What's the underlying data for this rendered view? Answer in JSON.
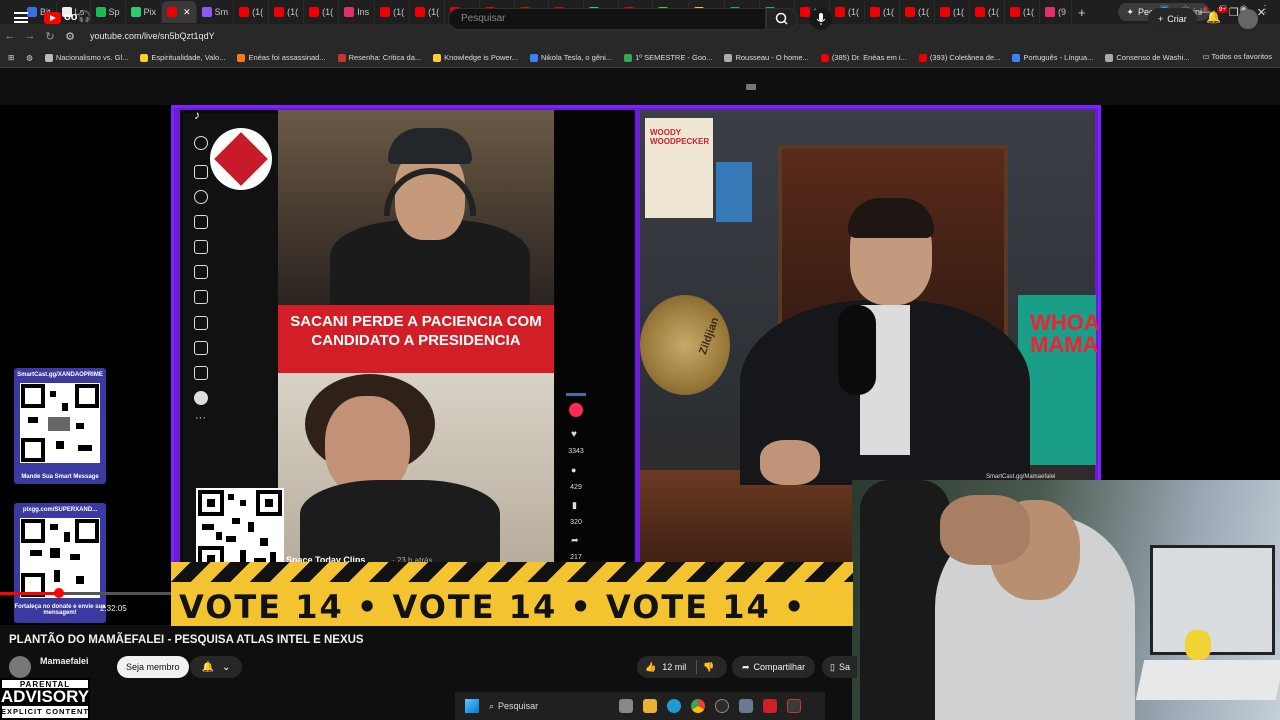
{
  "browser": {
    "tabs": [
      "Bit",
      "Lo",
      "Sp",
      "Pix",
      "",
      "Sm",
      "(1(",
      "(1(",
      "(1(",
      "Ins",
      "(1(",
      "(1(",
      "(1(",
      "(1(",
      "Yo",
      "(1(",
      "(1)",
      "Tri",
      "Str",
      "Cir",
      "Sh",
      "Str",
      "(1(",
      "(1(",
      "(1(",
      "(1(",
      "(1(",
      "(1(",
      "(1(",
      "(9"
    ],
    "new_tab": "+",
    "gemini_label": "Peça ao Gemini",
    "url": "youtube.com/live/sn5bQzt1qdY",
    "bookmarks": [
      "Nacionalismo vs. Gl...",
      "Espiritualidade, Valo...",
      "Enéas foi assassinad...",
      "Resenha: Crítica da...",
      "Knowledge is Power...",
      "Nikola Tesla, o gêni...",
      "1º SEMESTRE - Goo...",
      "Rousseau - O home...",
      "(385) Dr. Enéas em i...",
      "(393) Coletânea de...",
      "Português - Língua...",
      "Consenso de Washi..."
    ],
    "all_favorites": "Todos os favoritos"
  },
  "youtube": {
    "search_placeholder": "Pesquisar",
    "create_label": "Criar",
    "notif_badge": "9+"
  },
  "stream": {
    "banner_line1": "SACANI PERDE A PACIENCIA COM",
    "banner_line2": "CANDIDATO A PRESIDENCIA",
    "tiktok_counts": [
      "3343",
      "429",
      "320",
      "217"
    ],
    "tiktok_channel": "Space Today Clips",
    "tiktok_time": "· 23 h atrás",
    "poster_text": "WHOA MAMA",
    "woody_text": "WOODY WOODPECKER",
    "cymbal_text": "Zildjian",
    "smartcast_tag": "SmartCast.gg/Mamaefalei",
    "ticker_text": "VOTE 14  •  VOTE 14  •  VOTE 14  •",
    "qr1_top": "SmartCast.gg/XANDAOPRIME",
    "qr1_bottom": "Mande Sua Smart Message",
    "qr2_top": "pixgg.com/SUPERXAND...",
    "qr2_bottom": "Fortaleça no donate e envie sua mensagem!"
  },
  "player": {
    "timecode": "2:32:05",
    "video_title": "PLANTÃO DO MAMÃEFALEI - PESQUISA ATLAS INTEL E NEXUS",
    "channel_name": "Mamaefalei",
    "member_button": "Seja membro",
    "likes": "12 mil",
    "share_label": "Compartilhar",
    "save_label": "Sa"
  },
  "advisory": {
    "line1": "PARENTAL",
    "line2": "ADVISORY",
    "line3": "EXPLICIT CONTENT"
  },
  "taskbar": {
    "search_label": "Pesquisar"
  },
  "colors": {
    "frame": "#7a22ff",
    "banner": "#d21f27",
    "ticker": "#f4c430",
    "yt_red": "#ff0000"
  }
}
